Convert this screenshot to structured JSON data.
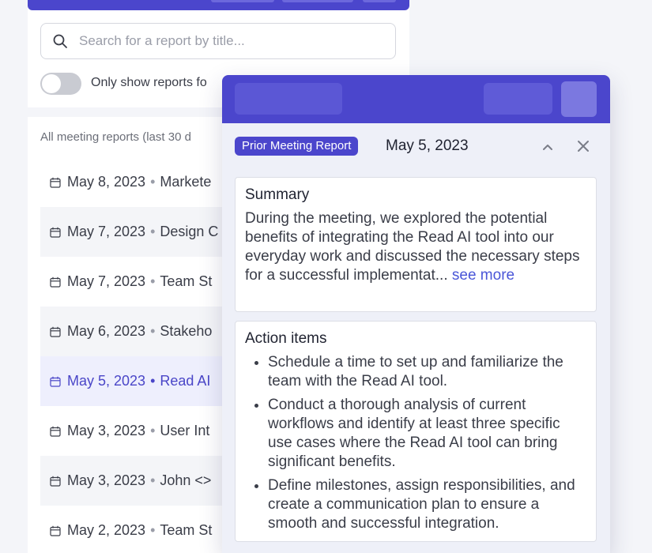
{
  "search": {
    "placeholder": "Search for a report by title..."
  },
  "filter": {
    "toggle_label": "Only show reports fo"
  },
  "list": {
    "header": "All meeting reports (last 30 d",
    "items": [
      {
        "date": "May 8, 2023",
        "title": "Markete"
      },
      {
        "date": "May 7, 2023",
        "title": "Design C"
      },
      {
        "date": "May 7, 2023",
        "title": "Team St"
      },
      {
        "date": "May 6, 2023",
        "title": "Stakeho"
      },
      {
        "date": "May 5, 2023",
        "title": "Read AI"
      },
      {
        "date": "May 3, 2023",
        "title": "User Int"
      },
      {
        "date": "May 3, 2023",
        "title": "John <>"
      },
      {
        "date": "May 2, 2023",
        "title": "Team St"
      }
    ]
  },
  "popup": {
    "badge": "Prior Meeting Report",
    "date": "May 5, 2023",
    "summary": {
      "title": "Summary",
      "text": "During the meeting, we explored the potential benefits of integrating the Read AI tool into our everyday work and discussed the necessary steps for a successful implementat...",
      "see_more": "see more"
    },
    "actions": {
      "title": "Action items",
      "items": [
        "Schedule a time to set up and familiarize the team with the Read AI tool.",
        "Conduct a thorough analysis of current workflows and identify at least three specific use cases where the Read AI tool can bring significant benefits.",
        "Define milestones, assign responsibilities, and create a communication plan to ensure a smooth and successful integration."
      ]
    }
  },
  "colors": {
    "accent": "#4b46cc",
    "active_row_text": "#4a46c8",
    "link": "#4a56d8"
  },
  "icons": {
    "search": "search-icon",
    "calendar": "calendar-icon",
    "collapse": "chevron-up-icon",
    "close": "close-icon"
  }
}
